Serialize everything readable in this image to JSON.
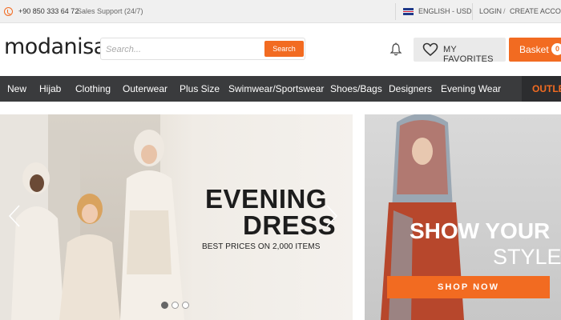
{
  "topbar": {
    "phone": "+90 850 333 64 72",
    "support": "Sales Support (24/7)",
    "language": "ENGLISH - USD",
    "login": "LOGIN",
    "separator": "/",
    "create_account": "CREATE ACCOUNT"
  },
  "header": {
    "logo": "modanisa",
    "search": {
      "placeholder": "Search...",
      "button": "Search"
    },
    "favorites_label": "MY FAVORITES",
    "basket_label": "Basket",
    "basket_count": "0"
  },
  "nav": {
    "items": [
      "New",
      "Hijab",
      "Clothing",
      "Outerwear",
      "Plus Size",
      "Swimwear/Sportswear",
      "Shoes/Bags",
      "Designers",
      "Evening Wear"
    ],
    "outlet": "OUTLET"
  },
  "hero": {
    "headline_line1": "EVENING",
    "headline_line2": "DRESS",
    "subline": "BEST PRICES ON 2,000 ITEMS",
    "slide_count": 3,
    "active_slide": 1
  },
  "promo": {
    "line1": "SHOW YOUR",
    "line2": "STYLE!",
    "button": "SHOP NOW"
  },
  "colors": {
    "accent": "#f26b21",
    "nav_bg": "#3a3b3d",
    "topbar_bg": "#f0f0f0"
  },
  "icons": [
    "phone-icon",
    "flag-icon",
    "bell-icon",
    "heart-icon",
    "chevron-left-icon",
    "chevron-right-icon"
  ]
}
